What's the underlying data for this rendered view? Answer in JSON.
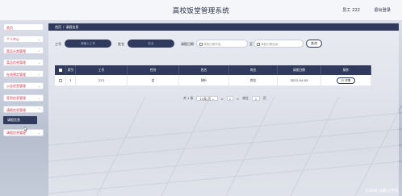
{
  "header": {
    "title": "高校饭堂管理系统",
    "user": "员工 222",
    "logout": "退出登录"
  },
  "sidebar": {
    "items": [
      {
        "label": "首页",
        "has_chevron": false
      },
      {
        "label": "个人中心",
        "has_chevron": true
      },
      {
        "label": "菜品分类管理",
        "has_chevron": true
      },
      {
        "label": "菜品信息管理",
        "has_chevron": true
      },
      {
        "label": "在线预定管理",
        "has_chevron": true
      },
      {
        "label": "公告信息管理",
        "has_chevron": true
      },
      {
        "label": "签到信息管理",
        "has_chevron": true
      },
      {
        "label": "请假信息管理",
        "has_chevron": true
      }
    ],
    "active_sub": "请假信息",
    "last_item": {
      "label": "请假信息管理",
      "has_chevron": true
    }
  },
  "breadcrumb": {
    "home": "首页",
    "separator": "/",
    "current": "请假信息"
  },
  "filters": {
    "gonghao_label": "工号",
    "gonghao_placeholder": "请输入工号",
    "name_label": "姓名",
    "name_placeholder": "姓名",
    "date_label": "请假日期",
    "date_start": "请假日期开始",
    "date_to": "至",
    "date_end": "请假日期结束",
    "search_button": "查询"
  },
  "table": {
    "headers": [
      "索引",
      "工号",
      "性别",
      "姓名",
      "岗位",
      "请假日期",
      "操作"
    ],
    "rows": [
      {
        "index": "1",
        "gonghao": "222",
        "gender": "女",
        "name": "胡叶",
        "post": "岗位",
        "date": "2022-04-05",
        "action": "详情"
      }
    ]
  },
  "pager": {
    "total_prefix": "共 1 条",
    "page_size": "10条/页",
    "prev": "<",
    "page": "1",
    "next": ">",
    "goto_label": "前往",
    "goto_value": "1",
    "goto_suffix": "页"
  },
  "watermark": "CSDN @枫少学长"
}
